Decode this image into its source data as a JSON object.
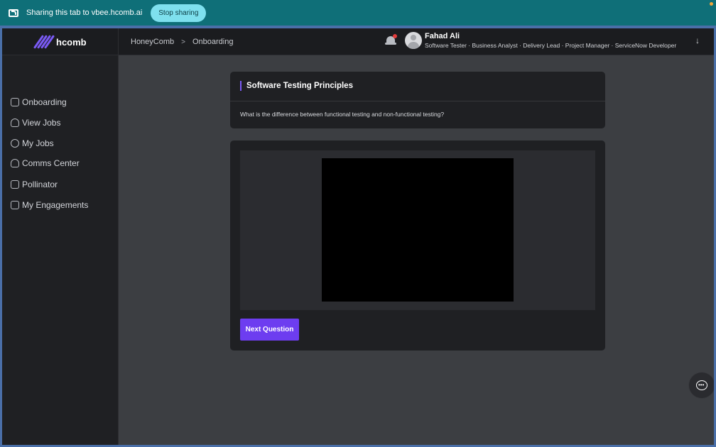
{
  "share_bar": {
    "text": "Sharing this tab to vbee.hcomb.ai",
    "stop_label": "Stop sharing"
  },
  "header": {
    "brand": "hcomb",
    "breadcrumb": [
      "HoneyComb",
      "Onboarding"
    ],
    "breadcrumb_sep": ">",
    "user_name": "Fahad Ali",
    "user_roles": "Software Tester · Business Analyst · Delivery Lead · Project Manager · ServiceNow Developer",
    "menu_icon": "arrow-down-icon"
  },
  "sidebar": {
    "items": [
      {
        "label": "Onboarding",
        "icon": "onboarding-icon"
      },
      {
        "label": "View Jobs",
        "icon": "person-icon"
      },
      {
        "label": "My Jobs",
        "icon": "group-icon"
      },
      {
        "label": "Comms Center",
        "icon": "person-icon"
      },
      {
        "label": "Pollinator",
        "icon": "document-icon"
      },
      {
        "label": "My Engagements",
        "icon": "briefcase-icon"
      }
    ]
  },
  "question_card": {
    "title": "Software Testing Principles",
    "question": "What is the difference between functional testing and non-functional testing?"
  },
  "video_card": {
    "next_label": "Next Question"
  },
  "colors": {
    "accent": "#6d3df0",
    "share_bar": "#0f6f78",
    "stop_button": "#7ee0ee",
    "notification_dot": "#e23b3b"
  }
}
